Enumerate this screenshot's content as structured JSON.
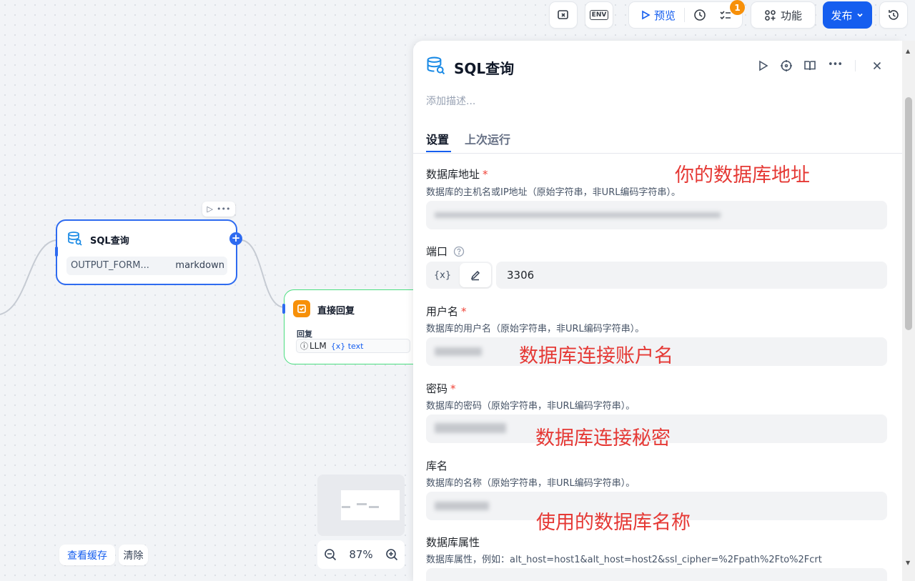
{
  "toolbar": {
    "preview_label": "预览",
    "badge_count": "1",
    "features_label": "功能",
    "publish_label": "发布",
    "env_label": "ENV"
  },
  "canvas": {
    "sql_node": {
      "title": "SQL查询",
      "param_name": "OUTPUT_FORM...",
      "param_value": "markdown"
    },
    "reply_node": {
      "title": "直接回复",
      "section_label": "回复",
      "llm_tag": "LLM",
      "var_tag": "{x} text"
    },
    "view_cache_label": "查看缓存",
    "clear_label": "清除",
    "zoom_label": "87%"
  },
  "panel": {
    "title": "SQL查询",
    "description_placeholder": "添加描述...",
    "tabs": [
      {
        "label": "设置",
        "active": true
      },
      {
        "label": "上次运行",
        "active": false
      }
    ],
    "fields": {
      "host": {
        "label": "数据库地址",
        "required_mark": "*",
        "desc": "数据库的主机名或IP地址（原始字符串，非URL编码字符串）。",
        "annotation": "你的数据库地址"
      },
      "port": {
        "label": "端口",
        "var_button": "{x}",
        "value": "3306"
      },
      "username": {
        "label": "用户名",
        "required_mark": "*",
        "desc": "数据库的用户名（原始字符串，非URL编码字符串）。",
        "annotation": "数据库连接账户名"
      },
      "password": {
        "label": "密码",
        "required_mark": "*",
        "desc": "数据库的密码（原始字符串，非URL编码字符串）。",
        "annotation": "数据库连接秘密"
      },
      "dbname": {
        "label": "库名",
        "desc": "数据库的名称（原始字符串，非URL编码字符串）。",
        "annotation": "使用的数据库名称"
      },
      "properties": {
        "label": "数据库属性",
        "desc": "数据库属性，例如：alt_host=host1&alt_host=host2&ssl_cipher=%2Fpath%2Fto%2Fcrt"
      }
    }
  },
  "colors": {
    "accent": "#155eef",
    "annotation": "#e53935",
    "badge": "#f79009",
    "reply_icon": "#f79009"
  }
}
